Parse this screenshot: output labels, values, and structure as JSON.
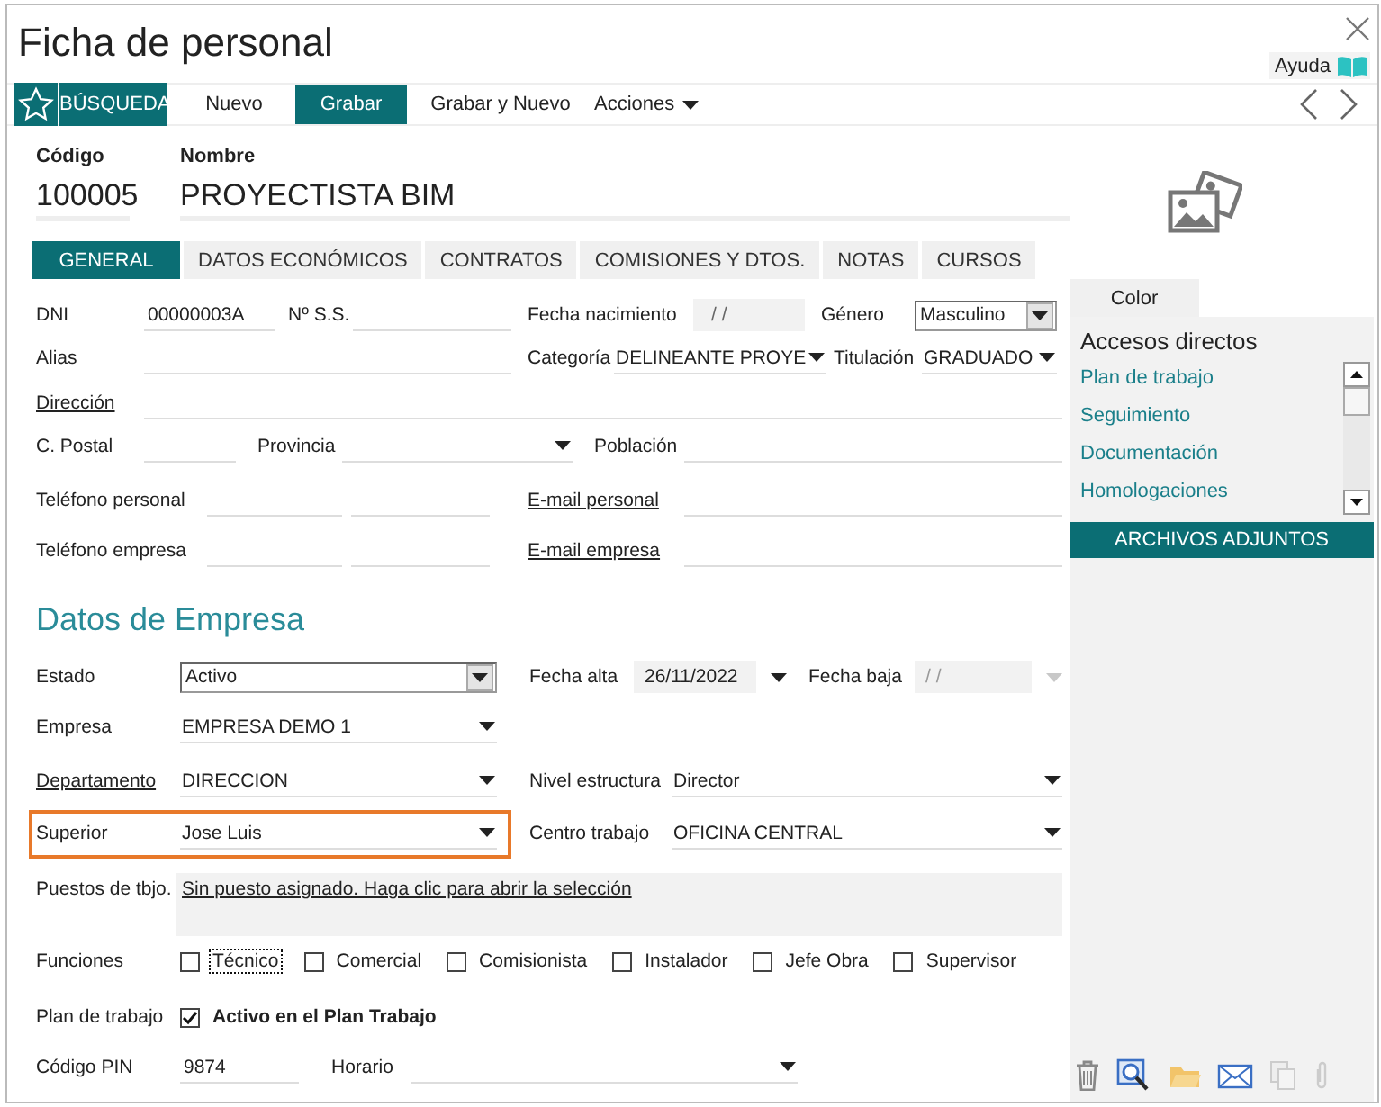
{
  "window": {
    "title": "Ficha de personal",
    "help": "Ayuda"
  },
  "toolbar": {
    "search": "BÚSQUEDA",
    "buttons": [
      {
        "label": "Nuevo",
        "selected": false
      },
      {
        "label": "Grabar",
        "selected": true
      },
      {
        "label": "Grabar y Nuevo",
        "selected": false
      }
    ],
    "menu": "Acciones"
  },
  "record": {
    "code_label": "Código",
    "code": "100005",
    "name_label": "Nombre",
    "name": "PROYECTISTA BIM"
  },
  "tabs": [
    {
      "label": "GENERAL",
      "selected": true
    },
    {
      "label": "DATOS ECONÓMICOS",
      "selected": false
    },
    {
      "label": "CONTRATOS",
      "selected": false
    },
    {
      "label": "COMISIONES Y DTOS.",
      "selected": false
    },
    {
      "label": "NOTAS",
      "selected": false
    },
    {
      "label": "CURSOS",
      "selected": false
    }
  ],
  "general": [
    [
      {
        "label": "DNI",
        "link": false,
        "kind": "text",
        "value": "00000003A"
      },
      {
        "label": "Nº S.S.",
        "link": false,
        "kind": "text"
      },
      {
        "label": "Fecha nacimiento",
        "link": false,
        "kind": "date",
        "value": "/ /",
        "disabled": false
      },
      {
        "label": "Género",
        "link": false,
        "kind": "combo",
        "value": "Masculino"
      }
    ],
    [
      {
        "label": "Alias",
        "link": false,
        "kind": "text"
      },
      {
        "label": "Categoría",
        "link": false,
        "kind": "select",
        "value": "DELINEANTE PROYE"
      },
      {
        "label": "Titulación",
        "link": false,
        "kind": "select",
        "value": "GRADUADO"
      }
    ],
    [
      {
        "label": "Dirección",
        "link": true,
        "kind": "text"
      }
    ],
    [
      {
        "label": "C. Postal",
        "link": false,
        "kind": "text"
      },
      {
        "label": "Provincia",
        "link": false,
        "kind": "select"
      },
      {
        "label": "Población",
        "link": false,
        "kind": "text"
      }
    ],
    [
      {
        "label": "Teléfono personal",
        "link": false,
        "kind": "pair"
      },
      {
        "label": "E-mail personal",
        "link": true,
        "kind": "text"
      }
    ],
    [
      {
        "label": "Teléfono empresa",
        "link": false,
        "kind": "pair"
      },
      {
        "label": "E-mail empresa",
        "link": true,
        "kind": "text"
      }
    ]
  ],
  "company": {
    "title": "Datos de Empresa",
    "rows": [
      [
        {
          "label": "Estado",
          "link": false,
          "highlighted": false,
          "kind": "combo",
          "value": "Activo"
        },
        {
          "label": "Fecha alta",
          "link": false,
          "highlighted": false,
          "kind": "datepicker",
          "value": "26/11/2022",
          "disabled": false
        },
        {
          "label": "Fecha baja",
          "link": false,
          "highlighted": false,
          "kind": "datepicker",
          "value": "/ /",
          "disabled": true
        }
      ],
      [
        {
          "label": "Empresa",
          "link": false,
          "highlighted": false,
          "kind": "select",
          "value": "EMPRESA DEMO 1"
        }
      ],
      [
        {
          "label": "Departamento",
          "link": true,
          "highlighted": false,
          "kind": "select",
          "value": "DIRECCION"
        },
        {
          "label": "Nivel estructura",
          "link": false,
          "highlighted": false,
          "kind": "select",
          "value": "Director"
        }
      ],
      [
        {
          "label": "Superior",
          "link": false,
          "highlighted": true,
          "kind": "select",
          "value": "Jose Luis"
        },
        {
          "label": "Centro trabajo",
          "link": false,
          "highlighted": false,
          "kind": "select",
          "value": "OFICINA CENTRAL"
        }
      ],
      [
        {
          "label": "Puestos de tbjo.",
          "link": false,
          "highlighted": false,
          "kind": "linkbox",
          "value": "Sin puesto asignado. Haga clic para abrir la selección"
        }
      ],
      [
        {
          "label": "Funciones",
          "link": false,
          "highlighted": false,
          "kind": "checks",
          "options": [
            {
              "label": "Técnico",
              "checked": false,
              "focused": true
            },
            {
              "label": "Comercial",
              "checked": false,
              "focused": false
            },
            {
              "label": "Comisionista",
              "checked": false,
              "focused": false
            },
            {
              "label": "Instalador",
              "checked": false,
              "focused": false
            },
            {
              "label": "Jefe Obra",
              "checked": false,
              "focused": false
            },
            {
              "label": "Supervisor",
              "checked": false,
              "focused": false
            }
          ]
        }
      ],
      [
        {
          "label": "Plan de trabajo",
          "link": false,
          "highlighted": false,
          "kind": "check",
          "option": {
            "label": "Activo en el Plan Trabajo",
            "checked": true
          }
        }
      ],
      [
        {
          "label": "Código PIN",
          "link": false,
          "highlighted": false,
          "kind": "text",
          "value": "9874"
        },
        {
          "label": "Horario",
          "link": false,
          "highlighted": false,
          "kind": "select"
        }
      ]
    ]
  },
  "side": {
    "tab": "Color",
    "shortcuts_title": "Accesos directos",
    "shortcuts": [
      "Plan de trabajo",
      "Seguimiento",
      "Documentación",
      "Homologaciones"
    ],
    "attachments": "ARCHIVOS ADJUNTOS"
  }
}
